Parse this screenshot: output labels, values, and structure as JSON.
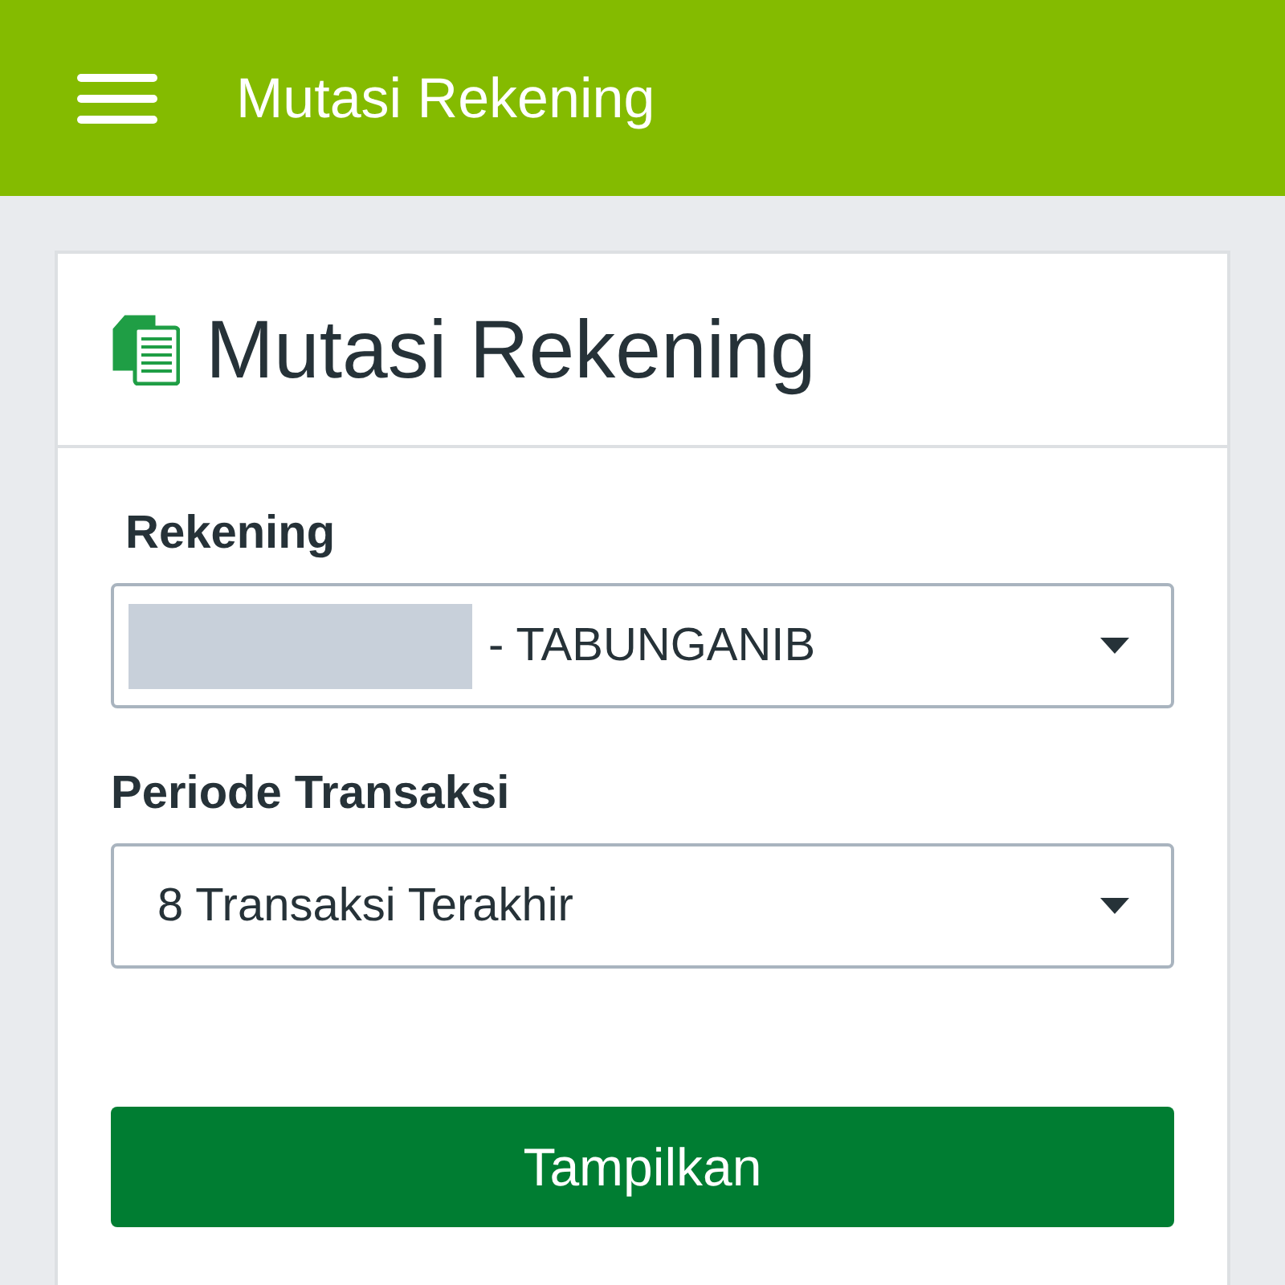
{
  "app_bar": {
    "title": "Mutasi Rekening"
  },
  "card": {
    "title": "Mutasi Rekening",
    "fields": [
      {
        "kind": "account",
        "label": "Rekening",
        "value": "- TABUNGANIB",
        "redacted": true
      },
      {
        "kind": "period",
        "label": "Periode Transaksi",
        "value": "8 Transaksi Terakhir",
        "redacted": false
      }
    ],
    "button": "Tampilkan"
  }
}
